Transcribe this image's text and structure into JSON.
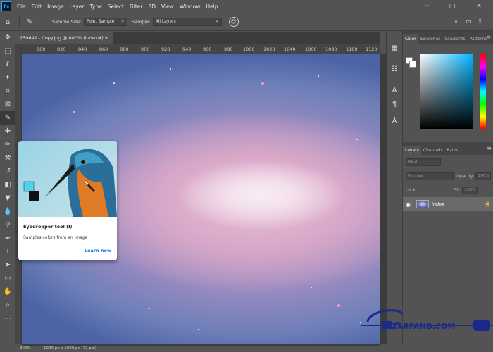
{
  "app": {
    "logo_text": "Ps"
  },
  "menu": [
    "File",
    "Edit",
    "Image",
    "Layer",
    "Type",
    "Select",
    "Filter",
    "3D",
    "View",
    "Window",
    "Help"
  ],
  "window_controls": {
    "minimize": "−",
    "maximize": "□",
    "close": "✕"
  },
  "options": {
    "sample_size_label": "Sample Size:",
    "sample_size_value": "Point Sample",
    "sample_label": "Sample:",
    "sample_value": "All Layers"
  },
  "document": {
    "tab_title": "250642 - Copy.jpg @ 800% (Index#) *",
    "close": "×"
  },
  "ruler_ticks": [
    "800",
    "820",
    "840",
    "860",
    "880",
    "900",
    "920",
    "940",
    "960",
    "980",
    "1000",
    "1020",
    "1040",
    "1060",
    "1080",
    "1100",
    "1120"
  ],
  "status": {
    "zoom": "800%",
    "doc_size": "1920 px x 1080 px (72 ppi)"
  },
  "color_panel": {
    "tabs": [
      "Color",
      "Swatches",
      "Gradients",
      "Patterns"
    ]
  },
  "layers_panel": {
    "tabs": [
      "Layers",
      "Channels",
      "Paths"
    ],
    "kind_placeholder": "Kind",
    "blend_mode": "Normal",
    "opacity_label": "Opacity:",
    "opacity_value": "100%",
    "lock_label": "Lock:",
    "fill_label": "Fill:",
    "fill_value": "100%",
    "layer_name": "Index"
  },
  "tooltip": {
    "title": "Eyedropper tool (I)",
    "description": "Samples colors from an image",
    "link": "Learn how"
  },
  "watermark": {
    "text": "ITARFAND.COM"
  },
  "colors": {
    "accent": "#1473e6",
    "ps_blue": "#31a8ff",
    "panel_bg": "#535353"
  }
}
